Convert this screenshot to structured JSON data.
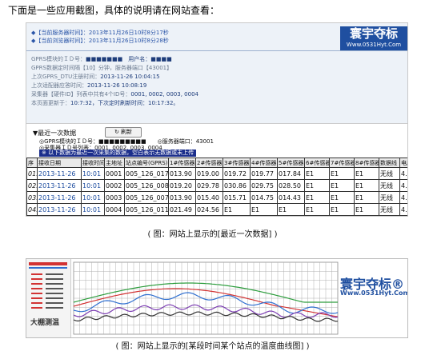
{
  "intro": "下面是一些应用截图，具体的说明请在网站查看：",
  "shot1": {
    "logo_name": "寰宇夺标",
    "logo_url": "Www.0531Hyt.Com",
    "header": [
      "◆【当前服务器时间】：2013年11月26日10时8分17秒",
      "◆【当前浏览器时间】：2013年11月26日10时8分28秒"
    ],
    "info": [
      {
        "label": "GPRS模块的ＩＤ号：",
        "value": "■■■■■■■　用户名：■■■■"
      },
      {
        "label": "GPRS数据定时间隔【10】分钟，服务器端口【43001】",
        "value": ""
      },
      {
        "label": "上次GPRS_DTU注册时间：",
        "value": "2013-11-26 10:04:15"
      },
      {
        "label": "上次适配器应答时间：",
        "value": "2013-11-26 10:08:19"
      },
      {
        "label": "采集器【硬件ID】列表中共有4个ID号：",
        "value": "0001, 0002, 0003, 0004"
      },
      {
        "label": "本页面更新于：",
        "value": "10:7:32，下次定时刷新时间：10:17:32。"
      }
    ],
    "recent_title": "▼最近一次数据",
    "refresh_button": "↻ 刷新",
    "status_lines": [
      "◎GPRS模块的ＩＤ号：■■■■■■■■■　　◎服务器端口：43001",
      "◎采集器ＩＤ号列表：0001, 0002, 0003, 0004"
    ],
    "warning": "※ 以下数据为最近一次采集的数据，空白表示无数据或未上传",
    "table": {
      "headers": [
        "序",
        "接收日期",
        "接收时间",
        "主地址",
        "站点编号(GPRS)",
        "1#传感器",
        "2#传感器",
        "3#传感器",
        "4#传感器",
        "5#传感器",
        "6#传感器",
        "7#传感器",
        "8#传感器",
        "数据线",
        "电压"
      ],
      "rows": [
        [
          "01.",
          "2013-11-26",
          "10:01",
          "0001",
          "005_126_017",
          "013.90",
          "019.00",
          "019.72",
          "019.77",
          "017.84",
          "E1",
          "E1",
          "E1",
          "无线",
          "4.3"
        ],
        [
          "02.",
          "2013-11-26",
          "10:01",
          "0002",
          "005_126_008",
          "019.20",
          "029.78",
          "030.86",
          "029.75",
          "028.50",
          "E1",
          "E1",
          "E1",
          "无线",
          "4.3"
        ],
        [
          "03.",
          "2013-11-26",
          "10:01",
          "0003",
          "005_126_007",
          "013.90",
          "015.40",
          "015.71",
          "014.75",
          "014.43",
          "E1",
          "E1",
          "E1",
          "无线",
          "4.3"
        ],
        [
          "04.",
          "2013-11-26",
          "10:01",
          "0004",
          "005_126_011",
          "021.49",
          "024.56",
          "E1",
          "E1",
          "E1",
          "E1",
          "E1",
          "E1",
          "无线",
          "4.3"
        ]
      ]
    }
  },
  "caption1": "( 图：网站上显示的[最近一次数据] )",
  "shot2": {
    "logo_name": "寰宇夺标®",
    "logo_url": "Www.0531Hyt.Com",
    "side_title": "大棚测温",
    "colors": {
      "grid": "#8a8a8a",
      "blue": "#2f6fd0",
      "red": "#d23333",
      "green": "#2e9e3e",
      "purple": "#7d3fb3",
      "black": "#333333"
    }
  },
  "caption2": "( 图：网站上显示的[某段时间某个站点的温度曲线图] )"
}
